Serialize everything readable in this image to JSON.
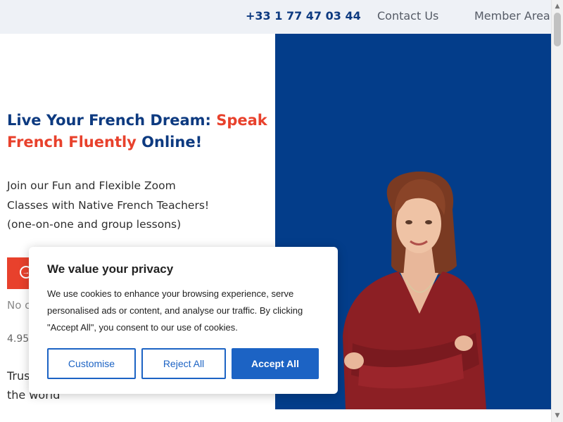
{
  "topbar": {
    "phone": "+33 1 77 47 03 44",
    "contact": "Contact Us",
    "member_area": "Member Area"
  },
  "hero": {
    "headline_part1": "Live Your French Dream: ",
    "headline_accent": "Speak French Fluently",
    "headline_part2": " Online!",
    "subtext_line1": "Join our Fun and Flexible Zoom",
    "subtext_line2": "Classes with Native French Teachers!",
    "subtext_line3": "(one-on-one and group lessons)",
    "cta_icon": "arrow-circle-icon",
    "no_card_partial": "No c",
    "rating_partial": "4.95",
    "trusted_line1": "Trus",
    "trusted_line2": "the world"
  },
  "cookie": {
    "title": "We value your privacy",
    "text": "We use cookies to enhance your browsing experience, serve personalised ads or content, and analyse our traffic. By clicking \"Accept All\", you consent to our use of cookies.",
    "customise": "Customise",
    "reject": "Reject All",
    "accept": "Accept All"
  },
  "colors": {
    "brand_blue": "#0d3a80",
    "accent_red": "#e8412c",
    "hero_panel": "#033d8a",
    "button_blue": "#1c63c4"
  }
}
